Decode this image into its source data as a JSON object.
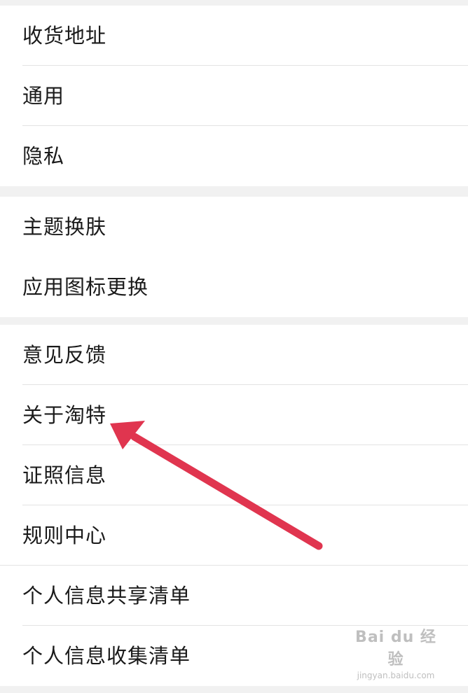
{
  "sections": [
    {
      "items": [
        {
          "label": "收货地址"
        },
        {
          "label": "通用"
        },
        {
          "label": "隐私"
        }
      ]
    },
    {
      "items": [
        {
          "label": "主题换肤"
        },
        {
          "label": "应用图标更换"
        }
      ]
    },
    {
      "items": [
        {
          "label": "意见反馈"
        },
        {
          "label": "关于淘特"
        },
        {
          "label": "证照信息"
        },
        {
          "label": "规则中心"
        },
        {
          "label": "个人信息共享清单"
        },
        {
          "label": "个人信息收集清单"
        }
      ]
    }
  ],
  "annotation": {
    "arrow_color": "#e0354f",
    "points_to": "关于淘特"
  },
  "watermark": {
    "main": "Bai du 经验",
    "sub": "jingyan.baidu.com"
  },
  "colors": {
    "background": "#f1f1f1",
    "card": "#ffffff",
    "text": "#1a1a1a",
    "divider": "#e3e3e3"
  }
}
